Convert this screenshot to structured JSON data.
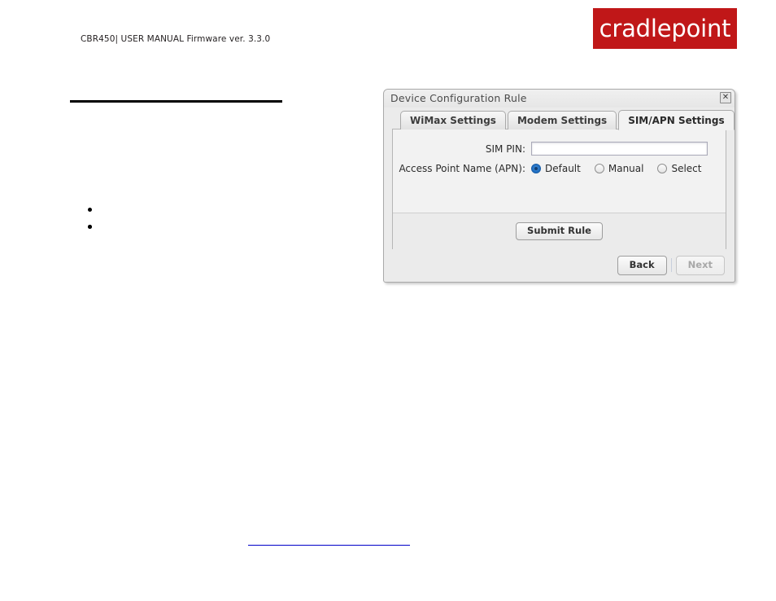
{
  "page": {
    "header_text": "CBR450| USER MANUAL Firmware ver. 3.3.0",
    "brand": "cradlepoint",
    "brand_color": "#c01718",
    "section_heading": "",
    "bullets": [
      "",
      "",
      ""
    ],
    "footer_link_text": ""
  },
  "dialog": {
    "title": "Device Configuration Rule",
    "close_glyph": "✕",
    "tabs": [
      {
        "label": "WiMax Settings",
        "active": false
      },
      {
        "label": "Modem Settings",
        "active": false
      },
      {
        "label": "SIM/APN Settings",
        "active": true
      }
    ],
    "fields": {
      "sim_pin_label": "SIM PIN:",
      "sim_pin_value": "",
      "sim_pin_placeholder": "",
      "apn_label": "Access Point Name (APN):",
      "apn_options": [
        {
          "label": "Default",
          "selected": true
        },
        {
          "label": "Manual",
          "selected": false
        },
        {
          "label": "Select",
          "selected": false
        }
      ]
    },
    "buttons": {
      "submit": "Submit Rule",
      "back": "Back",
      "next": "Next",
      "next_disabled": true
    }
  }
}
